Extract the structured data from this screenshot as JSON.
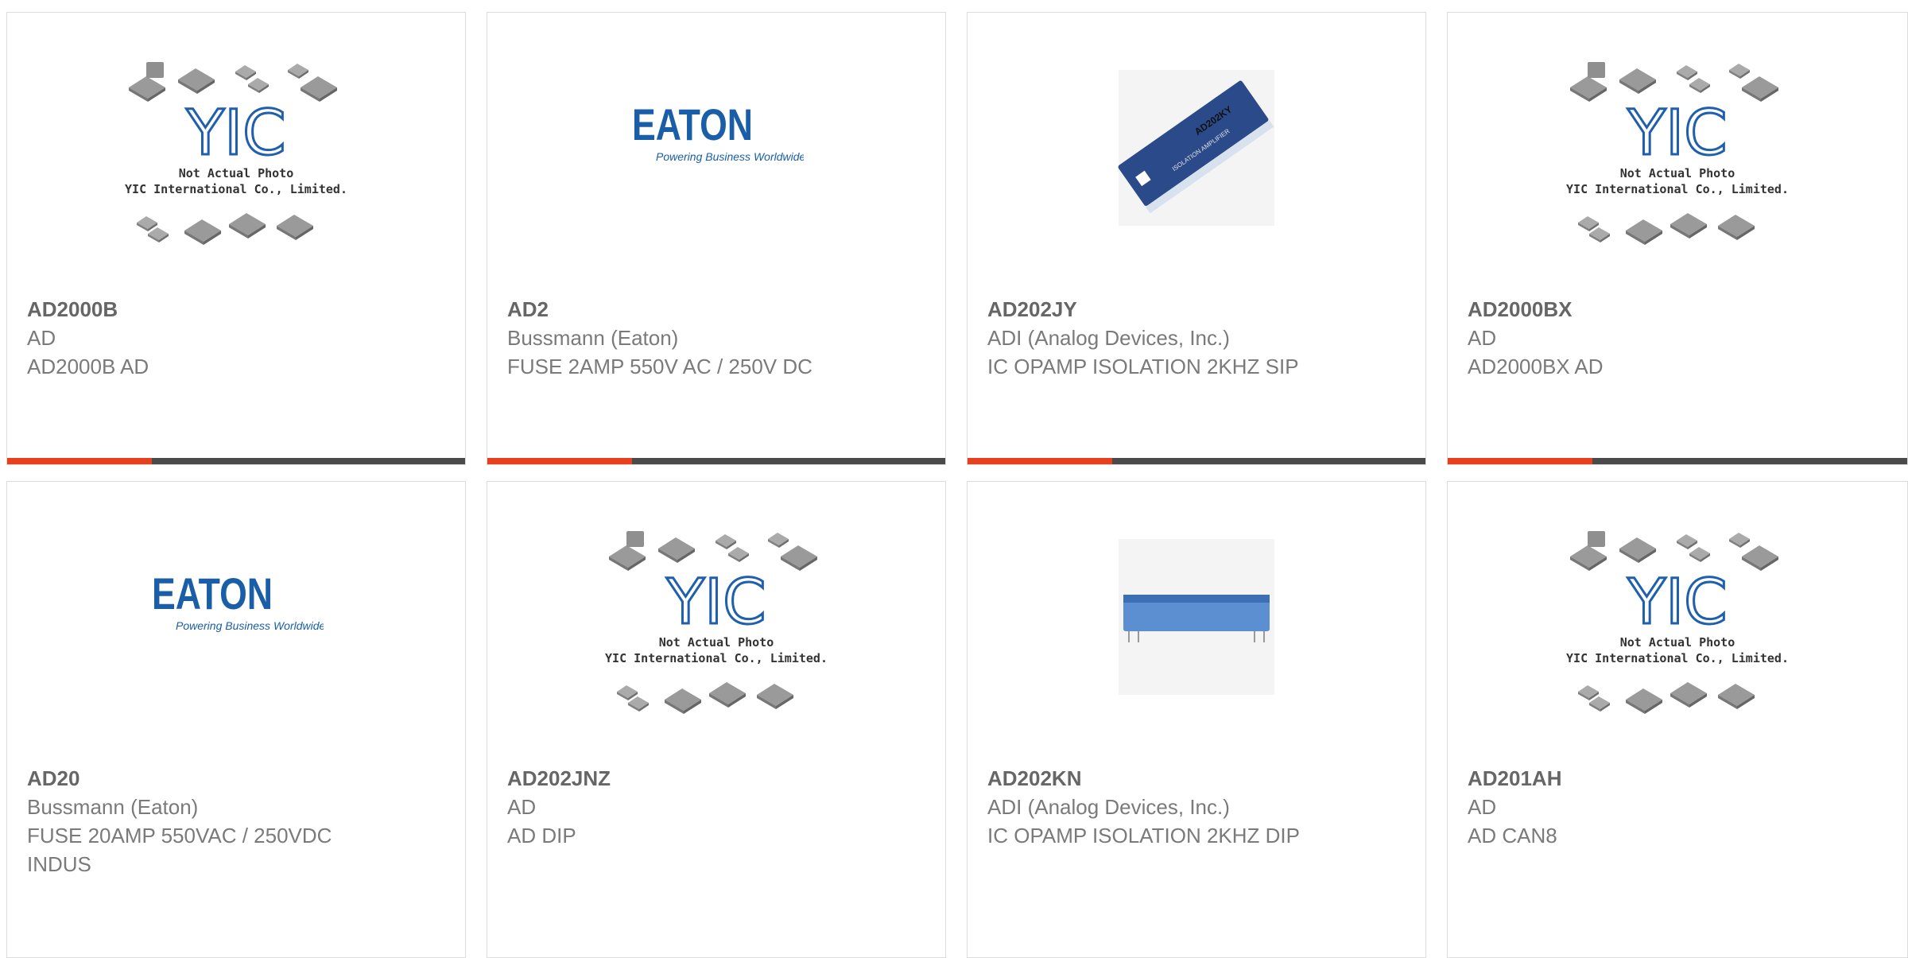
{
  "accent_color": "#e8401c",
  "bar_color": "#4a4a4a",
  "products": [
    {
      "part_number": "AD2000B",
      "manufacturer": "AD",
      "description": "AD2000B AD",
      "image": "yic-placeholder",
      "image_text_1": "Not Actual Photo",
      "image_text_2": "YIC International Co., Limited.",
      "logo_text": "YIC"
    },
    {
      "part_number": "AD2",
      "manufacturer": "Bussmann (Eaton)",
      "description": "FUSE 2AMP 550V AC / 250V DC",
      "image": "eaton-logo",
      "logo_text": "EATON",
      "logo_tagline": "Powering Business Worldwide"
    },
    {
      "part_number": "AD202JY",
      "manufacturer": "ADI (Analog Devices, Inc.)",
      "description": "IC OPAMP ISOLATION 2KHZ SIP",
      "image": "ic-sip-photo",
      "chip_label": "AD202KY",
      "chip_sublabel": "ISOLATION AMPLIFIER"
    },
    {
      "part_number": "AD2000BX",
      "manufacturer": "AD",
      "description": "AD2000BX AD",
      "image": "yic-placeholder",
      "image_text_1": "Not Actual Photo",
      "image_text_2": "YIC International Co., Limited.",
      "logo_text": "YIC"
    },
    {
      "part_number": "AD20",
      "manufacturer": "Bussmann (Eaton)",
      "description": "FUSE 20AMP 550VAC / 250VDC INDUS",
      "image": "eaton-logo",
      "logo_text": "EATON",
      "logo_tagline": "Powering Business Worldwide"
    },
    {
      "part_number": "AD202JNZ",
      "manufacturer": "AD",
      "description": "AD DIP",
      "image": "yic-placeholder",
      "image_text_1": "Not Actual Photo",
      "image_text_2": "YIC International Co., Limited.",
      "logo_text": "YIC"
    },
    {
      "part_number": "AD202KN",
      "manufacturer": "ADI (Analog Devices, Inc.)",
      "description": "IC OPAMP ISOLATION 2KHZ DIP",
      "image": "ic-dip-photo"
    },
    {
      "part_number": "AD201AH",
      "manufacturer": "AD",
      "description": "AD CAN8",
      "image": "yic-placeholder",
      "image_text_1": "Not Actual Photo",
      "image_text_2": "YIC International Co., Limited.",
      "logo_text": "YIC"
    }
  ]
}
